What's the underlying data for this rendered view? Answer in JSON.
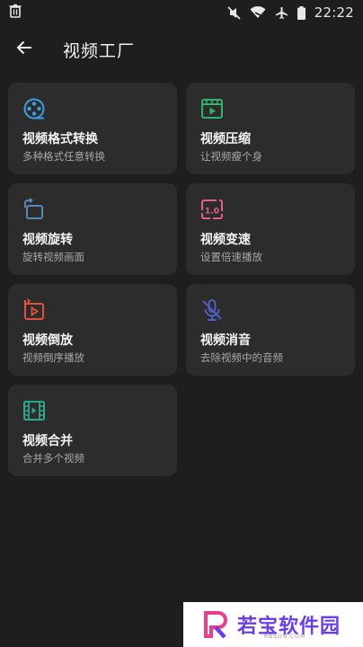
{
  "status_bar": {
    "time": "22:22",
    "icons": [
      "trash-icon",
      "mute-icon",
      "wifi-icon",
      "airplane-icon",
      "battery-icon"
    ]
  },
  "toolbar": {
    "title": "视频工厂",
    "back_icon": "back-arrow-icon"
  },
  "cards": [
    {
      "title": "视频格式转换",
      "desc": "多种格式任意转换",
      "icon": "film-reel-icon",
      "color": "#3b9fe6"
    },
    {
      "title": "视频压缩",
      "desc": "让视频瘦个身",
      "icon": "video-compress-icon",
      "color": "#33b36a"
    },
    {
      "title": "视频旋转",
      "desc": "旋转视频画面",
      "icon": "rotate-icon",
      "color": "#5a87b8"
    },
    {
      "title": "视频变速",
      "desc": "设置倍速播放",
      "icon": "speed-icon",
      "color": "#e0608a"
    },
    {
      "title": "视频倒放",
      "desc": "视频倒序播放",
      "icon": "reverse-play-icon",
      "color": "#e0533a"
    },
    {
      "title": "视频消音",
      "desc": "去除视频中的音频",
      "icon": "mute-mic-icon",
      "color": "#4f5ec4"
    },
    {
      "title": "视频合并",
      "desc": "合并多个视频",
      "icon": "film-strip-icon",
      "color": "#2ea58f"
    }
  ],
  "watermark": {
    "text": "若宝软件园",
    "sub": "RBSGN.COM",
    "color": "#6b3ee8"
  }
}
